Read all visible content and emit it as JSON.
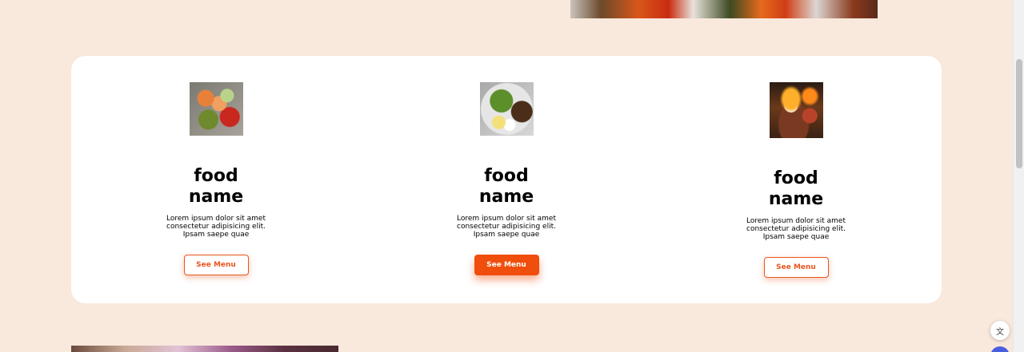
{
  "cards": [
    {
      "title": "food name",
      "description": "Lorem ipsum dolor sit amet consectetur adipisicing elit. Ipsam saepe quae",
      "button_label": "See Menu",
      "image_icon": "food-salad-shrimp-image"
    },
    {
      "title": "food name",
      "description": "Lorem ipsum dolor sit amet consectetur adipisicing elit. Ipsam saepe quae",
      "button_label": "See Menu",
      "image_icon": "food-green-salad-image"
    },
    {
      "title": "food name",
      "description": "Lorem ipsum dolor sit amet consectetur adipisicing elit. Ipsam saepe quae",
      "button_label": "See Menu",
      "image_icon": "food-grill-steak-image"
    }
  ],
  "floating": {
    "translate_icon": "translate-icon"
  },
  "colors": {
    "background": "#f9e8dc",
    "accent": "#f04e0c",
    "card": "#ffffff"
  }
}
